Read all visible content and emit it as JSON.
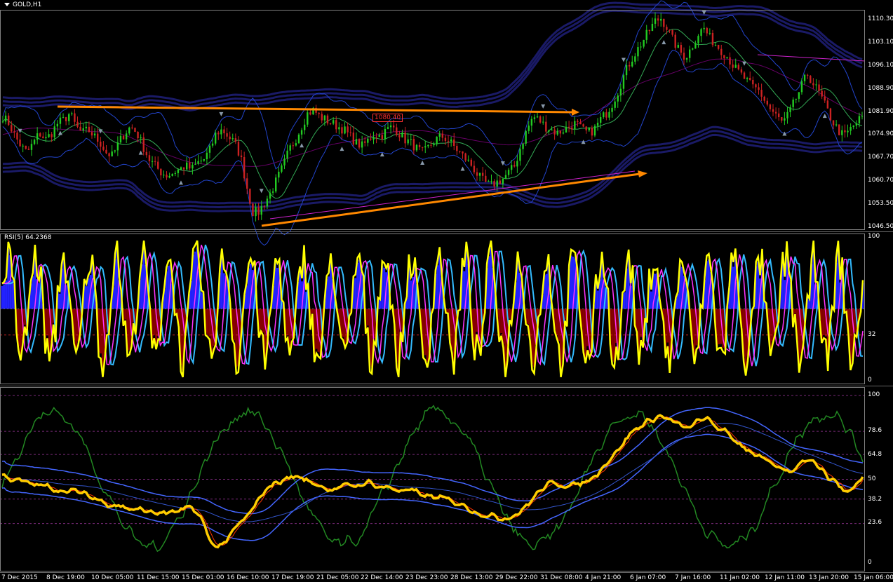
{
  "window": {
    "symbol_title": "GOLD,H1"
  },
  "main_panel": {
    "price_label": "1080.40",
    "y_ticks": [
      "1110.30",
      "1103.10",
      "1096.10",
      "1088.90",
      "1081.90",
      "1074.90",
      "1067.70",
      "1060.70",
      "1053.50",
      "1046.50"
    ]
  },
  "rsi_panel": {
    "title": "RSI(5) 64.2368",
    "y_ticks": [
      "100",
      "32",
      "0"
    ]
  },
  "stoch_panel": {
    "y_ticks": [
      "100",
      "78.6",
      "64.8",
      "50",
      "38.2",
      "23.6",
      "0"
    ]
  },
  "x_axis": {
    "ticks": [
      "7 Dec 2015",
      "8 Dec 19:00",
      "10 Dec 05:00",
      "11 Dec 15:00",
      "15 Dec 01:00",
      "16 Dec 10:00",
      "17 Dec 19:00",
      "21 Dec 05:00",
      "22 Dec 14:00",
      "23 Dec 23:00",
      "28 Dec 13:00",
      "29 Dec 22:00",
      "31 Dec 08:00",
      "4 Jan 21:00",
      "6 Jan 07:00",
      "7 Jan 16:00",
      "11 Jan 02:00",
      "12 Jan 11:00",
      "13 Jan 20:00",
      "15 Jan 06:00"
    ]
  },
  "colors": {
    "background": "#000000",
    "up_candle": "#22cc22",
    "down_candle": "#cc2222",
    "band": "#1a1a66",
    "rsi_yellow": "#ffff00",
    "rsi_cyan": "#33bbff",
    "rsi_magenta": "#ff33ff",
    "hist_blue": "#2222ff",
    "hist_red": "#880000",
    "stoch_gold": "#ffcc00",
    "stoch_green": "#228822",
    "stoch_blue": "#4466ff",
    "stoch_red": "#ff3300",
    "arrow_orange": "#ff8800"
  },
  "chart_data": [
    {
      "type": "candlestick",
      "title": "GOLD,H1",
      "ylim": [
        1046.5,
        1113.5
      ],
      "close_path": [
        1081,
        1079,
        1075,
        1072,
        1070,
        1073,
        1076,
        1074,
        1076,
        1079,
        1080,
        1082,
        1078,
        1076,
        1077,
        1075,
        1073,
        1070,
        1069,
        1073,
        1076,
        1078,
        1076,
        1072,
        1068,
        1066,
        1064,
        1063,
        1064,
        1065,
        1066,
        1065,
        1067,
        1068,
        1071,
        1076,
        1077,
        1075,
        1073,
        1069,
        1060,
        1052,
        1052,
        1055,
        1058,
        1062,
        1066,
        1071,
        1074,
        1078,
        1082,
        1083,
        1081,
        1080,
        1079,
        1078,
        1077,
        1075,
        1073,
        1072,
        1074,
        1076,
        1075,
        1077,
        1078,
        1076,
        1074,
        1073,
        1071,
        1070,
        1072,
        1074,
        1075,
        1074,
        1072,
        1070,
        1068,
        1066,
        1063,
        1061,
        1060,
        1061,
        1062,
        1064,
        1066,
        1072,
        1077,
        1081,
        1080,
        1078,
        1077,
        1076,
        1077,
        1078,
        1079,
        1077,
        1076,
        1077,
        1080,
        1082,
        1085,
        1089,
        1094,
        1098,
        1101,
        1104,
        1107,
        1110,
        1111,
        1108,
        1104,
        1101,
        1099,
        1102,
        1106,
        1108,
        1105,
        1103,
        1101,
        1099,
        1096,
        1094,
        1092,
        1090,
        1089,
        1086,
        1083,
        1081,
        1079,
        1082,
        1086,
        1090,
        1094,
        1091,
        1088,
        1084,
        1080,
        1077,
        1075,
        1077,
        1079,
        1081
      ]
    },
    {
      "type": "line",
      "title": "RSI(5) 64.2368",
      "ylim": [
        0,
        100
      ],
      "levels": [
        32,
        50
      ],
      "series": [
        {
          "name": "RSI(5)",
          "last_value": 64.2368
        }
      ]
    },
    {
      "type": "line",
      "ylim": [
        0,
        100
      ],
      "levels": [
        23.6,
        38.2,
        50,
        64.8,
        78.6,
        100
      ],
      "series": [
        {
          "name": "",
          "values": [
            52,
            50,
            48,
            47,
            46,
            45,
            44,
            43,
            42,
            40,
            38,
            36,
            35,
            33,
            32,
            31,
            30,
            30,
            30,
            31,
            33,
            28,
            12,
            10,
            15,
            22,
            28,
            35,
            45,
            48,
            50,
            52,
            50,
            48,
            46,
            44,
            45,
            46,
            47,
            48,
            46,
            45,
            44,
            43,
            42,
            40,
            39,
            38,
            37,
            35,
            32,
            30,
            28,
            27,
            28,
            30,
            35,
            42,
            46,
            48,
            47,
            46,
            48,
            52,
            58,
            64,
            70,
            78,
            82,
            85,
            88,
            86,
            82,
            80,
            84,
            86,
            82,
            78,
            74,
            70,
            66,
            62,
            58,
            56,
            54,
            60,
            64,
            58,
            52,
            48,
            42,
            46,
            52
          ]
        }
      ]
    }
  ]
}
